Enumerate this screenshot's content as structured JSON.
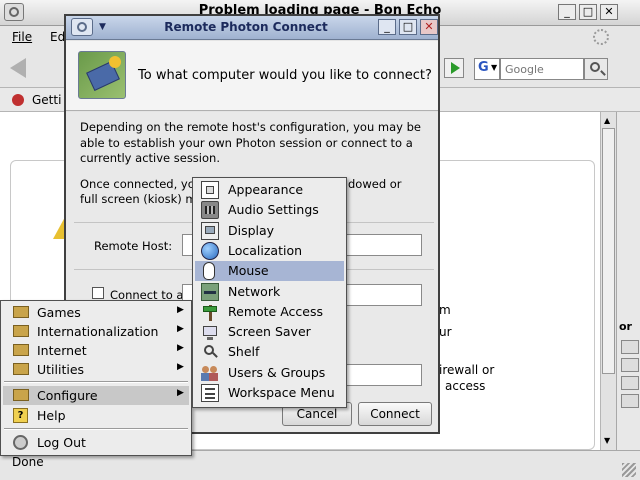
{
  "browser": {
    "title": "Problem loading page - Bon Echo",
    "menu": [
      "File",
      "Ed"
    ],
    "search_placeholder": "Google",
    "search_engine_letter": "G",
    "bookmark_label": "Getti",
    "status": "Done",
    "right_panel_label": "or"
  },
  "background_text": {
    "line1": "m",
    "line2": "ur",
    "line3": "irewall or",
    "line4": "access"
  },
  "dialog": {
    "title": "Remote Photon Connect",
    "header_question": "To what computer would you like to connect?",
    "para1": "Depending on the remote host's configuration, you may be able to establish your own Photon session or connect to a currently active session.",
    "para2_line1_start": "Once connected, yo",
    "para2_line1_end": "dowed or",
    "para2_line2_start": "full screen (kiosk) m",
    "remote_host_label": "Remote Host:",
    "remote_host_value": "",
    "checkbox_label": "Connect to act",
    "cancel_label": "Cancel",
    "connect_label": "Connect"
  },
  "main_menu": {
    "items": [
      {
        "label": "Games",
        "icon": "folder-icon",
        "submenu": true
      },
      {
        "label": "Internationalization",
        "icon": "folder-icon",
        "submenu": true
      },
      {
        "label": "Internet",
        "icon": "folder-icon",
        "submenu": true
      },
      {
        "label": "Utilities",
        "icon": "folder-icon",
        "submenu": true
      },
      {
        "label": "Configure",
        "icon": "folder-icon",
        "submenu": true,
        "selected": true
      },
      {
        "label": "Help",
        "icon": "help-icon",
        "submenu": false
      },
      {
        "label": "Log Out",
        "icon": "logout-icon",
        "submenu": false
      }
    ]
  },
  "configure_menu": {
    "items": [
      {
        "label": "Appearance",
        "icon": "appearance-icon"
      },
      {
        "label": "Audio Settings",
        "icon": "audio-icon"
      },
      {
        "label": "Display",
        "icon": "display-icon"
      },
      {
        "label": "Localization",
        "icon": "globe-icon"
      },
      {
        "label": "Mouse",
        "icon": "mouse-icon",
        "selected": true
      },
      {
        "label": "Network",
        "icon": "network-icon"
      },
      {
        "label": "Remote Access",
        "icon": "signpost-icon"
      },
      {
        "label": "Screen Saver",
        "icon": "screensaver-icon"
      },
      {
        "label": "Shelf",
        "icon": "shelf-icon"
      },
      {
        "label": "Users & Groups",
        "icon": "users-icon"
      },
      {
        "label": "Workspace Menu",
        "icon": "workspace-icon"
      }
    ]
  },
  "colors": {
    "menu_highlight": "#a7b5d4",
    "dialog_title_text": "#1c2a5c",
    "close_button": "#d04040"
  }
}
